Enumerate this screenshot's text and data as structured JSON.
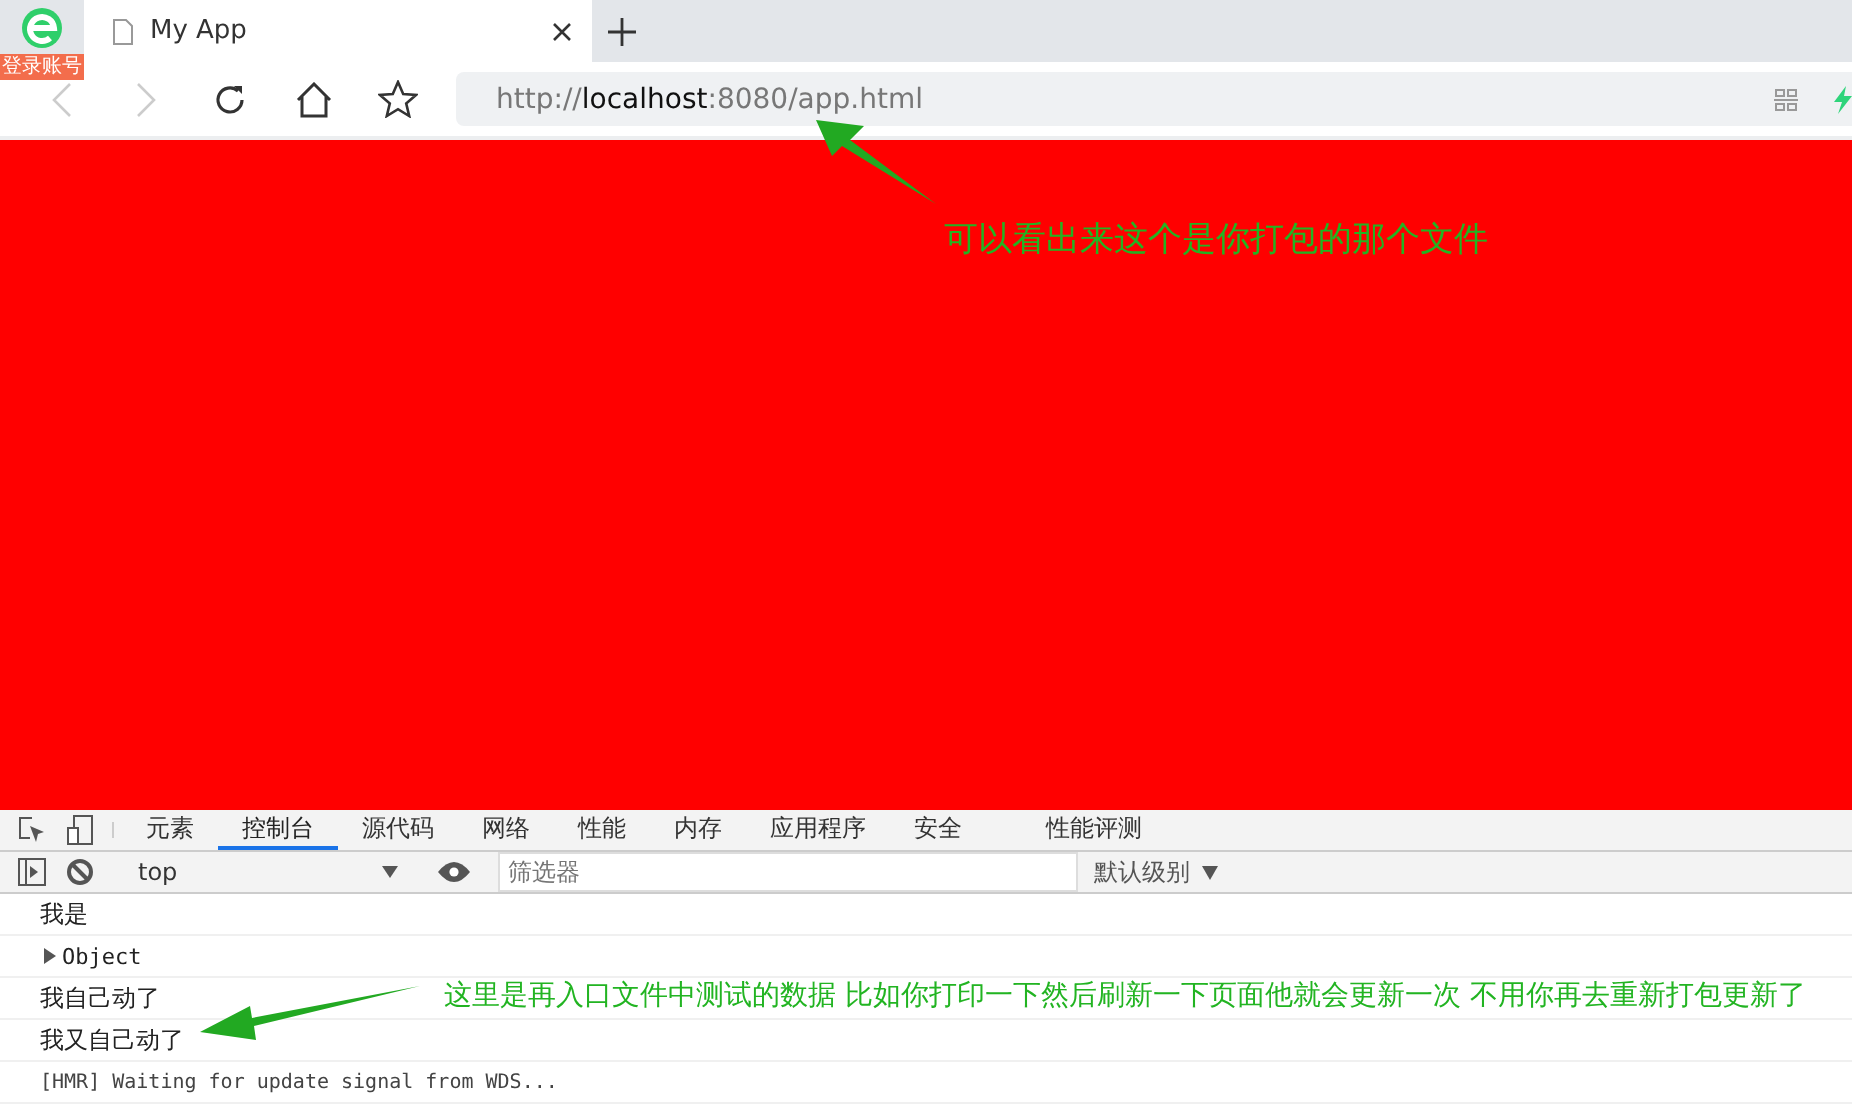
{
  "browser": {
    "badge": "登录账号",
    "tab": {
      "title": "My App"
    },
    "url": {
      "scheme": "http://",
      "host": "localhost",
      "rest": ":8080/app.html"
    }
  },
  "devtools": {
    "tabs": [
      {
        "label": "元素",
        "selected": false
      },
      {
        "label": "控制台",
        "selected": true
      },
      {
        "label": "源代码",
        "selected": false
      },
      {
        "label": "网络",
        "selected": false
      },
      {
        "label": "性能",
        "selected": false
      },
      {
        "label": "内存",
        "selected": false
      },
      {
        "label": "应用程序",
        "selected": false
      },
      {
        "label": "安全",
        "selected": false
      },
      {
        "label": "性能评测",
        "selected": false
      }
    ],
    "context": "top",
    "filter": {
      "placeholder": "筛选器"
    },
    "level": "默认级别",
    "console": [
      {
        "kind": "text",
        "text": "我是"
      },
      {
        "kind": "object",
        "text": "Object"
      },
      {
        "kind": "text",
        "text": "我自己动了"
      },
      {
        "kind": "text",
        "text": "我又自己动了"
      },
      {
        "kind": "mono",
        "text": "[HMR] Waiting for update signal from WDS..."
      }
    ]
  },
  "annotations": [
    {
      "text": "可以看出来这个是你打包的那个文件"
    },
    {
      "text": "这里是再入口文件中测试的数据  比如你打印一下然后刷新一下页面他就会更新一次 不用你再去重新打包更新了"
    }
  ]
}
